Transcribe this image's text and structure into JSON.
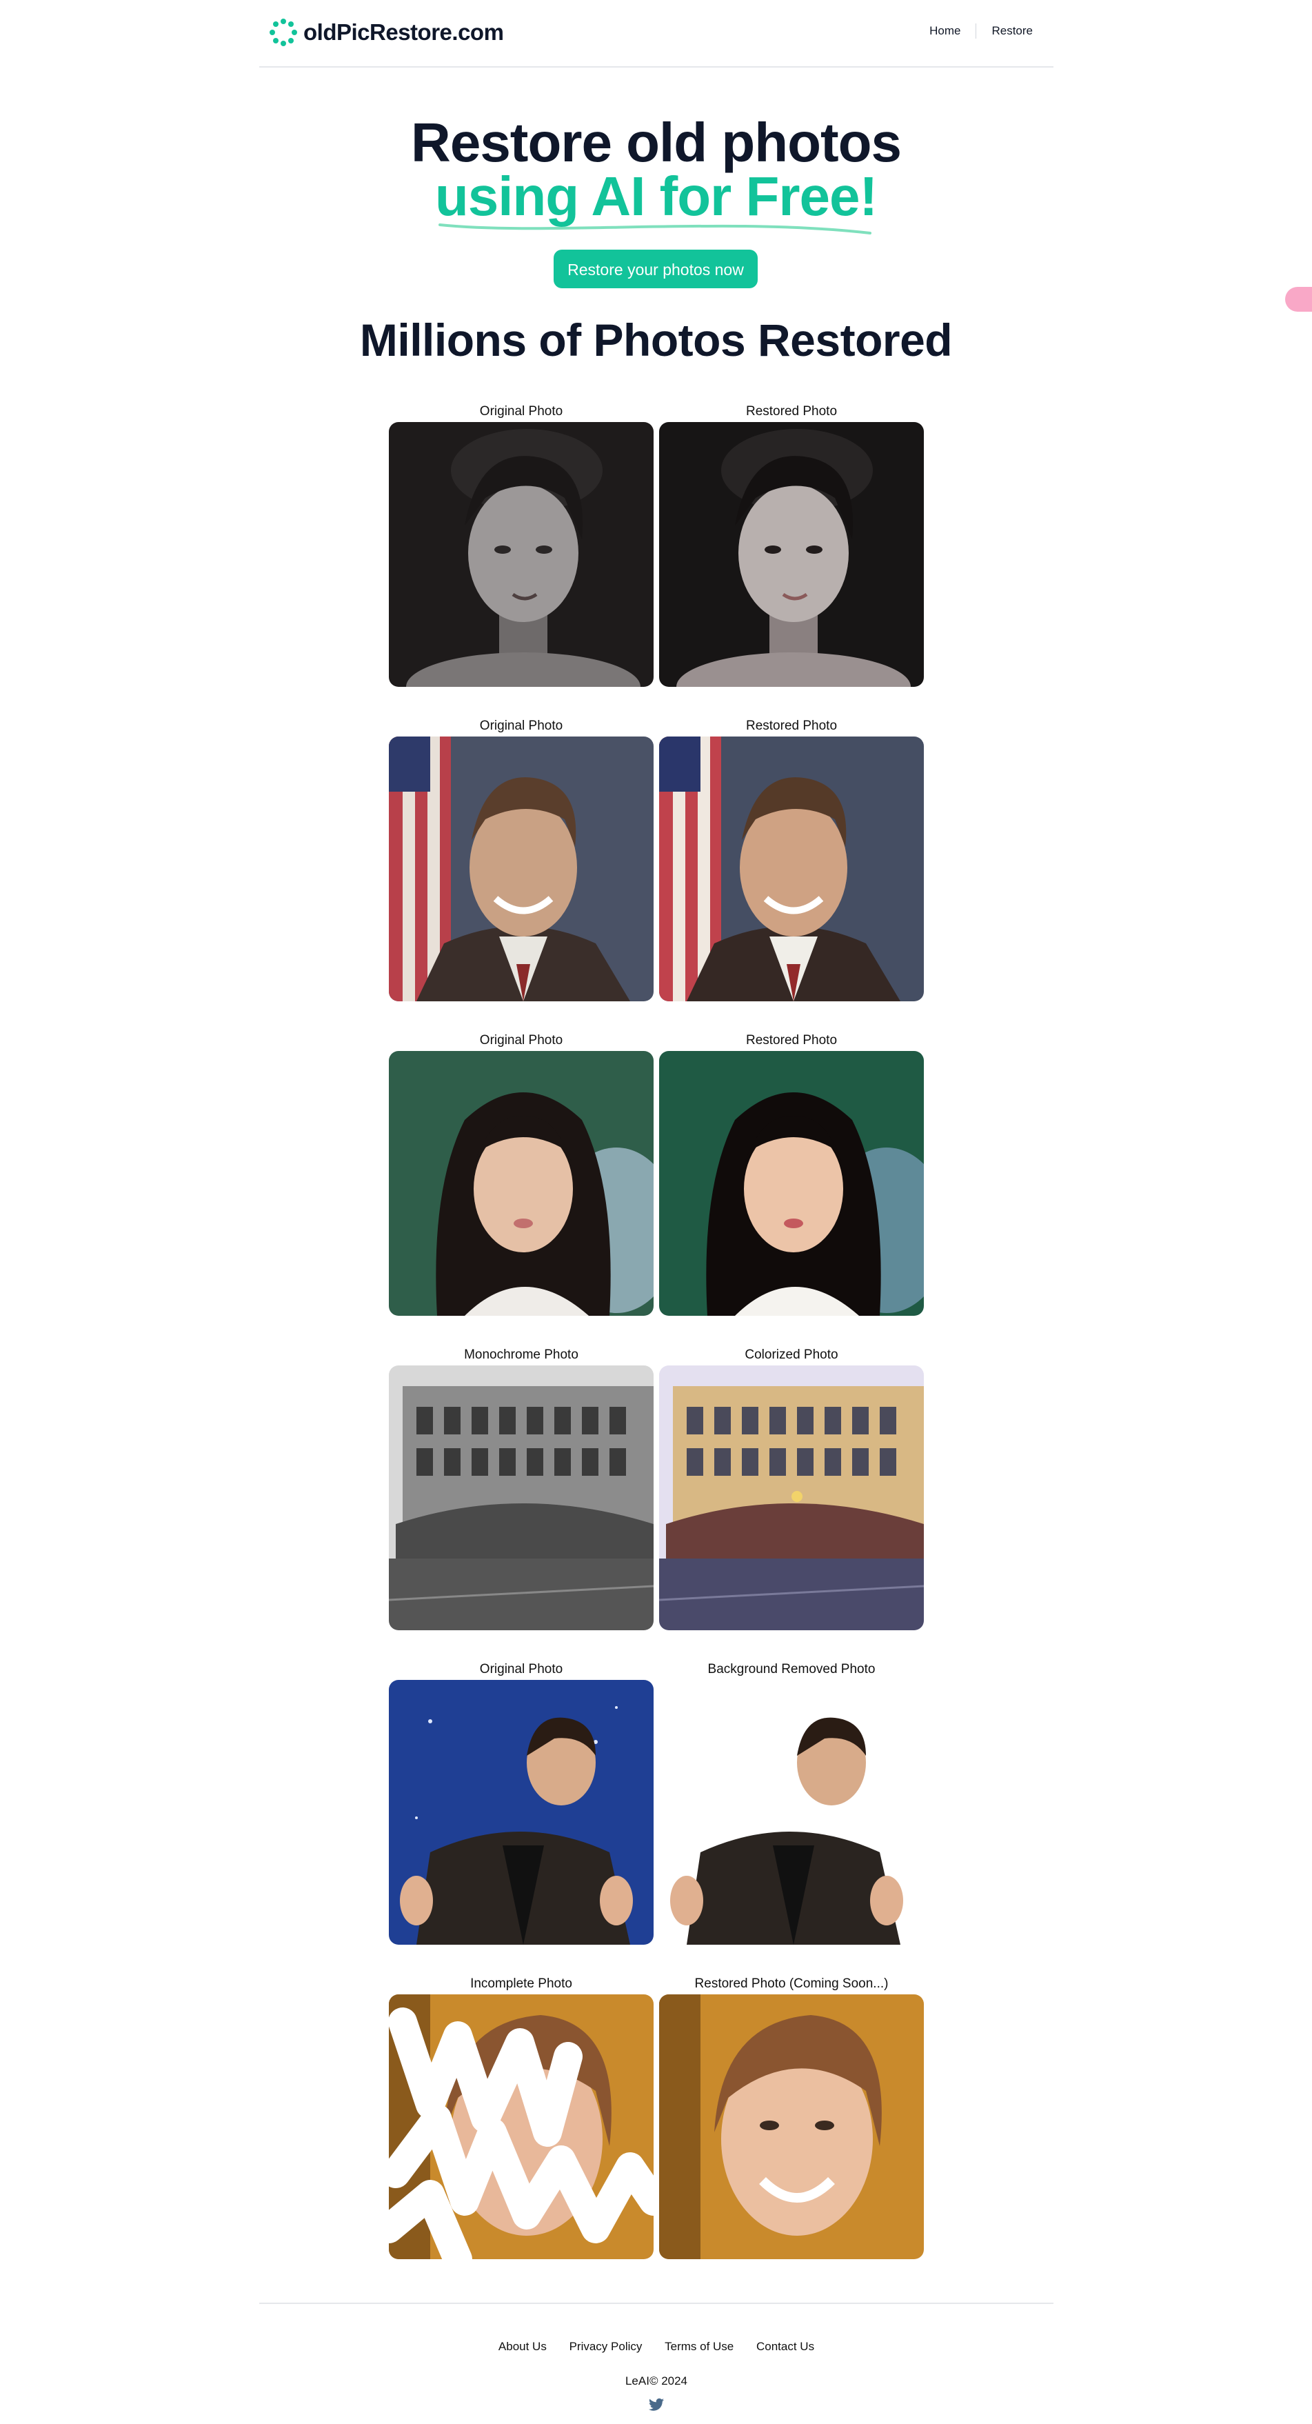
{
  "header": {
    "logo_text": "oldPicRestore.com",
    "nav": [
      {
        "label": "Home"
      },
      {
        "label": "Restore"
      }
    ]
  },
  "hero": {
    "line1": "Restore old photos",
    "line2": "using AI for Free!",
    "cta_label": "Restore your photos now",
    "subtitle": "Millions of Photos Restored"
  },
  "gallery": [
    {
      "left": "Original Photo",
      "right": "Restored Photo",
      "subject": "woman-portrait-bw"
    },
    {
      "left": "Original Photo",
      "right": "Restored Photo",
      "subject": "man-portrait-flag"
    },
    {
      "left": "Original Photo",
      "right": "Restored Photo",
      "subject": "girl-portrait-color"
    },
    {
      "left": "Monochrome Photo",
      "right": "Colorized Photo",
      "subject": "building-street"
    },
    {
      "left": "Original Photo",
      "right": "Background Removed Photo",
      "subject": "man-thumbs-up"
    },
    {
      "left": "Incomplete Photo",
      "right": "Restored Photo (Coming Soon...)",
      "subject": "woman-smiling"
    }
  ],
  "footer": {
    "links": [
      {
        "label": "About Us"
      },
      {
        "label": "Privacy Policy"
      },
      {
        "label": "Terms of Use"
      },
      {
        "label": "Contact Us"
      }
    ],
    "copyright": "LeAI© 2024"
  },
  "colors": {
    "accent": "#12c39a",
    "heading": "#0f172a",
    "divider": "#e5e7eb"
  },
  "icons": {
    "logo": "sparkle-ring-icon",
    "social": "twitter-icon"
  }
}
